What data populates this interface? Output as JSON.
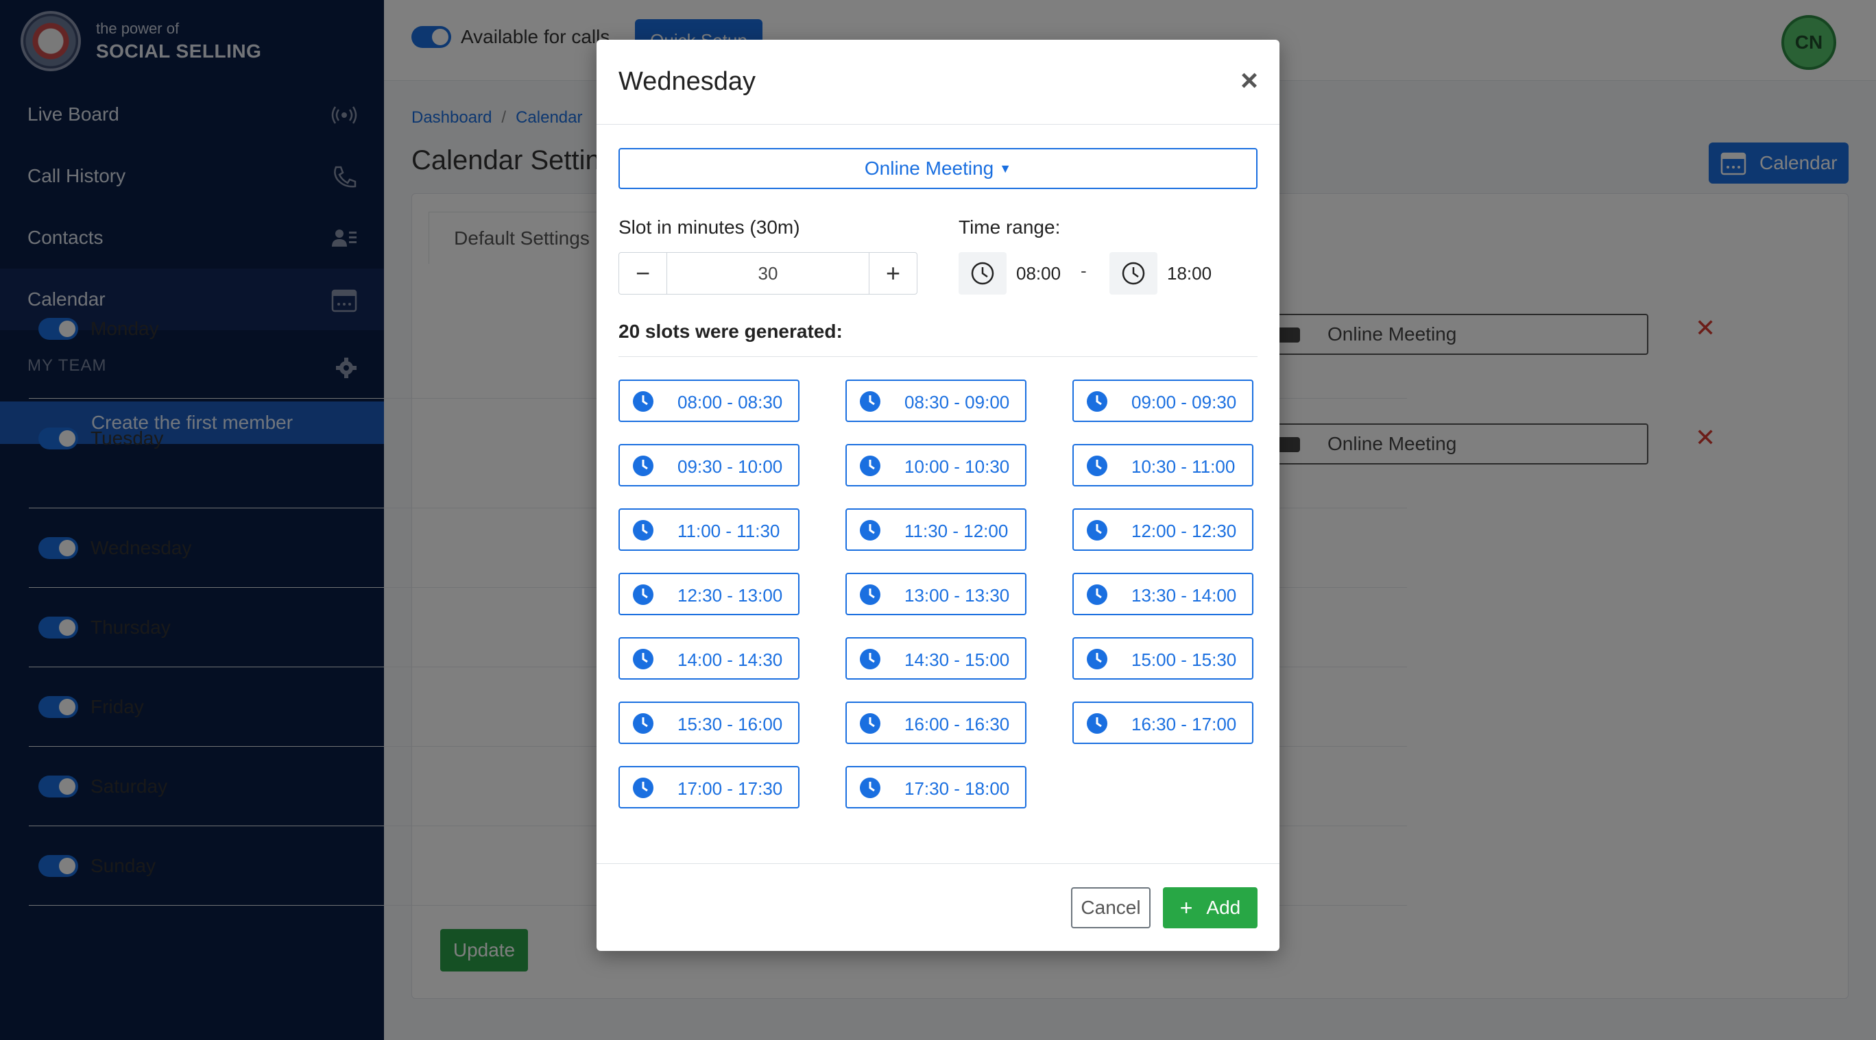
{
  "sidebar": {
    "logo_small": "the power of",
    "logo_big": "SOCIAL SELLING",
    "items": [
      {
        "label": "Live Board",
        "icon": "broadcast-icon"
      },
      {
        "label": "Call History",
        "icon": "phone-icon"
      },
      {
        "label": "Contacts",
        "icon": "contacts-icon"
      },
      {
        "label": "Calendar",
        "icon": "calendar-icon"
      }
    ],
    "section": "MY TEAM",
    "create_button": "Create the first member"
  },
  "topbar": {
    "available_label": "Available for calls",
    "quick_button": "Quick Setup",
    "avatar": "CN"
  },
  "breadcrumb": {
    "items": [
      "Dashboard",
      "Calendar"
    ]
  },
  "page": {
    "title": "Calendar Settings",
    "calendar_button": "Calendar",
    "tab": "Default Settings",
    "days": [
      "Monday",
      "Tuesday",
      "Wednesday",
      "Thursday",
      "Friday",
      "Saturday",
      "Sunday"
    ],
    "meeting_labels": [
      "Online Meeting",
      "Online Meeting"
    ],
    "update_button": "Update"
  },
  "modal": {
    "title": "Wednesday",
    "close": "×",
    "meeting_type": "Online Meeting",
    "slot_label": "Slot in minutes (30m)",
    "slot_value": "30",
    "range_label": "Time range:",
    "range_start": "08:00",
    "range_dash": "-",
    "range_end": "18:00",
    "generated_text": "20 slots were generated:",
    "slots": [
      "08:00 - 08:30",
      "08:30 - 09:00",
      "09:00 - 09:30",
      "09:30 - 10:00",
      "10:00 - 10:30",
      "10:30 - 11:00",
      "11:00 - 11:30",
      "11:30 - 12:00",
      "12:00 - 12:30",
      "12:30 - 13:00",
      "13:00 - 13:30",
      "13:30 - 14:00",
      "14:00 - 14:30",
      "14:30 - 15:00",
      "15:00 - 15:30",
      "15:30 - 16:00",
      "16:00 - 16:30",
      "16:30 - 17:00",
      "17:00 - 17:30",
      "17:30 - 18:00"
    ],
    "cancel_button": "Cancel",
    "add_button": "Add"
  },
  "colors": {
    "primary": "#1a6fe0",
    "success": "#28a745",
    "sidebar": "#0b1f47",
    "danger": "#d93b30"
  }
}
